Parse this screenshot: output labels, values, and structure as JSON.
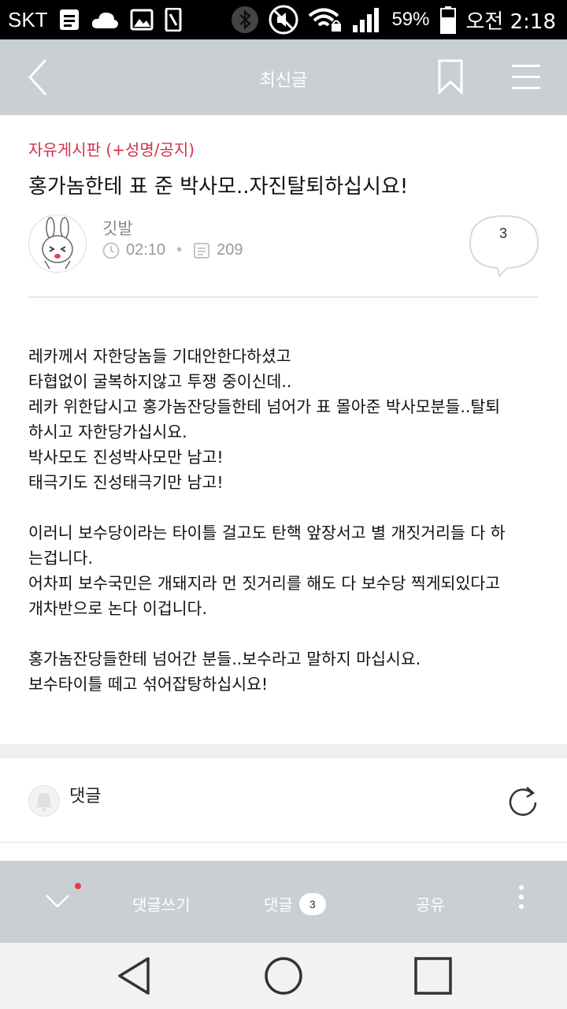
{
  "status_bar": {
    "carrier": "SKT",
    "battery_percent": "59%",
    "time": "오전 2:18",
    "icons": [
      "document-icon",
      "cloud-icon",
      "image-icon",
      "phone-frame-icon",
      "bluetooth-icon",
      "mute-icon",
      "wifi-lock-icon",
      "signal-icon",
      "battery-icon"
    ]
  },
  "header": {
    "title": "최신글",
    "icons": [
      "back-arrow-icon",
      "bookmark-icon",
      "hamburger-menu-icon"
    ]
  },
  "post": {
    "board": "자유게시판 (+성명/공지)",
    "title": "홍가놈한테 표 준 박사모..자진탈퇴하십시요!",
    "author": "깃발",
    "time": "02:10",
    "views": "209",
    "comment_count": "3",
    "body": [
      "레카께서 자한당놈들 기대안한다하셨고",
      "타협없이 굴복하지않고 투쟁 중이신데..",
      "레카 위한답시고 홍가놈잔당들한테 넘어가 표 몰아준 박사모분들..탈퇴",
      "하시고 자한당가십시요.",
      "박사모도 진성박사모만 남고!",
      "태극기도 진성태극기만 남고!",
      "",
      "이러니 보수당이라는 타이틀 걸고도 탄핵 앞장서고 별 개짓거리들 다 하",
      "는겁니다.",
      "어차피 보수국민은 개돼지라 먼 짓거리를 해도 다 보수당 찍게되있다고",
      "개차반으로 논다 이겁니다.",
      "",
      "홍가놈잔당들한테 넘어간 분들..보수라고 말하지 마십시요.",
      "보수타이틀 떼고 섞어잡탕하십시요!"
    ]
  },
  "comments_section": {
    "label": "댓글"
  },
  "action_bar": {
    "write": "댓글쓰기",
    "comments": "댓글",
    "comments_badge": "3",
    "share": "공유"
  },
  "colors": {
    "header_bg": "#c9cfd3",
    "board_accent": "#d2344a",
    "notification_dot": "#e43b4f"
  }
}
